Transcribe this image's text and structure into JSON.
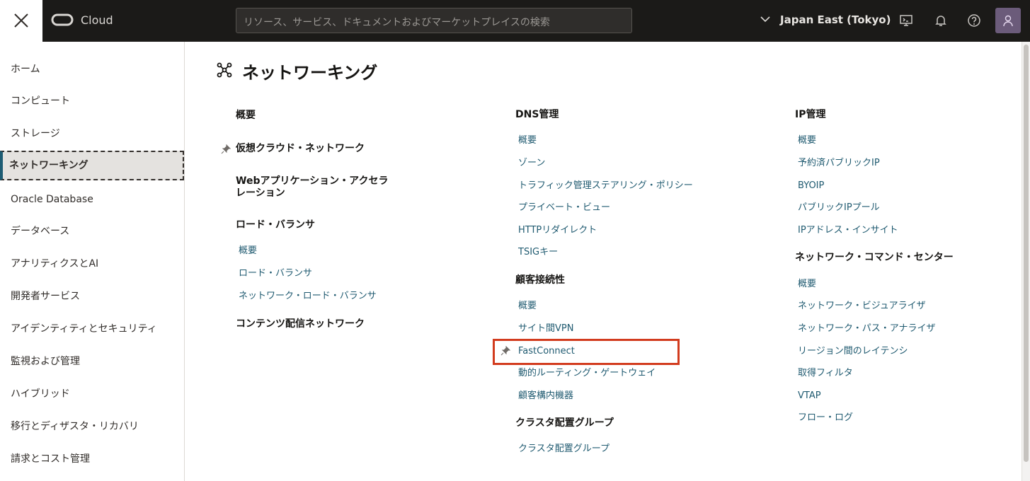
{
  "topbar": {
    "brand": "Cloud",
    "search_placeholder": "リソース、サービス、ドキュメントおよびマーケットプレイスの検索",
    "region": "Japan East (Tokyo)"
  },
  "sidebar": {
    "items": [
      {
        "label": "ホーム"
      },
      {
        "label": "コンピュート"
      },
      {
        "label": "ストレージ"
      },
      {
        "label": "ネットワーキング"
      },
      {
        "label": "Oracle Database"
      },
      {
        "label": "データベース"
      },
      {
        "label": "アナリティクスとAI"
      },
      {
        "label": "開発者サービス"
      },
      {
        "label": "アイデンティティとセキュリティ"
      },
      {
        "label": "監視および管理"
      },
      {
        "label": "ハイブリッド"
      },
      {
        "label": "移行とディザスタ・リカバリ"
      },
      {
        "label": "請求とコスト管理"
      }
    ]
  },
  "main": {
    "title": "ネットワーキング",
    "col1": {
      "overview": "概要",
      "vcn": "仮想クラウド・ネットワーク",
      "waa_line1": "Webアプリケーション・アクセラ",
      "waa_line2": "レーション",
      "lb_heading": "ロード・バランサ",
      "lb_links": [
        "概要",
        "ロード・バランサ",
        "ネットワーク・ロード・バランサ"
      ],
      "cdn": "コンテンツ配信ネットワーク"
    },
    "col2": {
      "dns_heading": "DNS管理",
      "dns_links": [
        "概要",
        "ゾーン",
        "トラフィック管理ステアリング・ポリシー",
        "プライベート・ビュー",
        "HTTPリダイレクト",
        "TSIGキー"
      ],
      "cc_heading": "顧客接続性",
      "cc_links": [
        "概要",
        "サイト間VPN",
        "FastConnect",
        "動的ルーティング・ゲートウェイ",
        "顧客構内機器"
      ],
      "cpg_heading": "クラスタ配置グループ",
      "cpg_links": [
        "クラスタ配置グループ"
      ]
    },
    "col3": {
      "ip_heading": "IP管理",
      "ip_links": [
        "概要",
        "予約済パブリックIP",
        "BYOIP",
        "パブリックIPプール",
        "IPアドレス・インサイト"
      ],
      "ncc_heading": "ネットワーク・コマンド・センター",
      "ncc_links": [
        "概要",
        "ネットワーク・ビジュアライザ",
        "ネットワーク・パス・アナライザ",
        "リージョン間のレイテンシ",
        "取得フィルタ",
        "VTAP",
        "フロー・ログ"
      ]
    }
  },
  "colors": {
    "link": "#1f5a70",
    "highlight": "#d23b1e",
    "topbar": "#1b1a18"
  }
}
